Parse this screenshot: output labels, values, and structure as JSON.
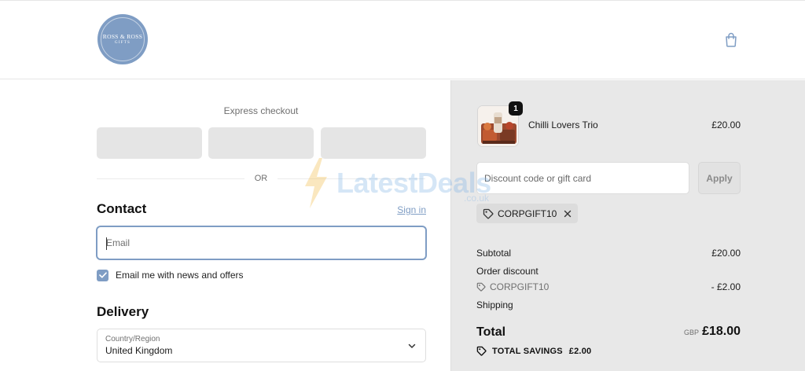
{
  "header": {
    "logo": {
      "name": "ROSS & ROSS",
      "sub": "GIFTS"
    },
    "cart_icon": "shopping-bag-icon"
  },
  "checkout": {
    "express_label": "Express checkout",
    "or_label": "OR",
    "contact": {
      "title": "Contact",
      "signin_label": "Sign in",
      "email_placeholder": "Email",
      "news_label": "Email me with news and offers",
      "news_checked": true
    },
    "delivery": {
      "title": "Delivery",
      "country_label": "Country/Region",
      "country_value": "United Kingdom"
    }
  },
  "summary": {
    "item": {
      "name": "Chilli Lovers Trio",
      "price": "£20.00",
      "quantity": "1"
    },
    "discount_placeholder": "Discount code or gift card",
    "apply_label": "Apply",
    "applied_code": "CORPGIFT10",
    "subtotal_label": "Subtotal",
    "subtotal_value": "£20.00",
    "order_discount_label": "Order discount",
    "discount_code": "CORPGIFT10",
    "discount_value": "- £2.00",
    "shipping_label": "Shipping",
    "total_label": "Total",
    "currency": "GBP",
    "total_value": "£18.00",
    "savings_label": "TOTAL SAVINGS",
    "savings_value": "£2.00"
  },
  "watermark": {
    "text": "LatestDeals",
    "sub": ".co.uk"
  },
  "colors": {
    "accent": "#7f9dc4",
    "summary_bg": "#e8e8e8",
    "watermark": "#7fb2e5"
  }
}
